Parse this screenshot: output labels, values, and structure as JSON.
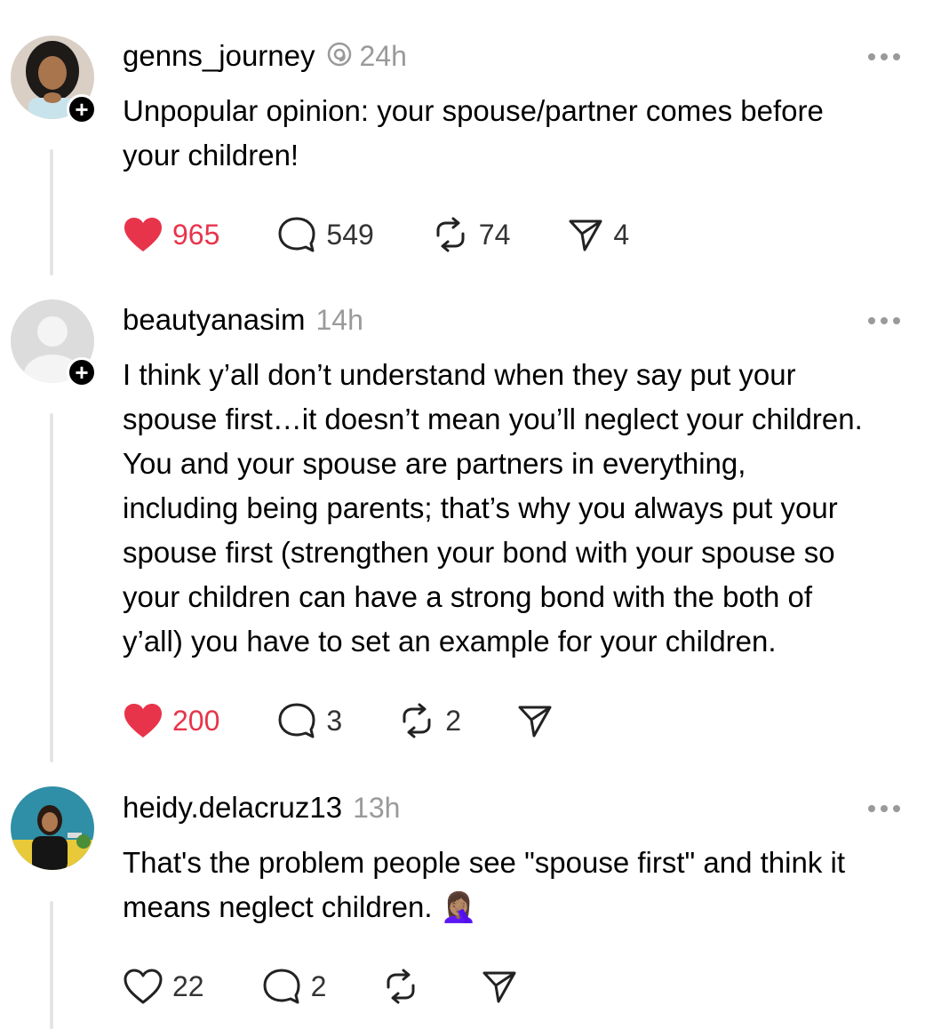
{
  "posts": [
    {
      "username": "genns_journey",
      "time": "24h",
      "text": "Unpopular opinion: your spouse/partner comes before\nyour children!",
      "likes": "965",
      "comments": "549",
      "reposts": "74",
      "shares": "4",
      "liked": true,
      "show_follow": true,
      "verified_icon": "threads-icon"
    },
    {
      "username": "beautyanasim",
      "time": "14h",
      "text": "I think y’all don’t understand when they say put your\nspouse first…it doesn’t mean you’ll neglect your children.\nYou and your spouse are partners in everything,\nincluding being parents; that’s why you always put your\nspouse first (strengthen your bond with your spouse so\nyour children can have a strong bond with the both of\ny’all) you have to set an example for your children.",
      "likes": "200",
      "comments": "3",
      "reposts": "2",
      "shares": "",
      "liked": true,
      "show_follow": true
    },
    {
      "username": "heidy.delacruz13",
      "time": "13h",
      "text": "That's the problem people see \"spouse first\" and think it\nmeans neglect children.",
      "emoji": "🤦🏽‍♀️",
      "likes": "22",
      "comments": "2",
      "reposts": "",
      "shares": "",
      "liked": false,
      "show_follow": false
    }
  ],
  "colors": {
    "like": "#e8344b",
    "muted": "#9a9a9a",
    "thread_line": "#e5e5e5"
  }
}
